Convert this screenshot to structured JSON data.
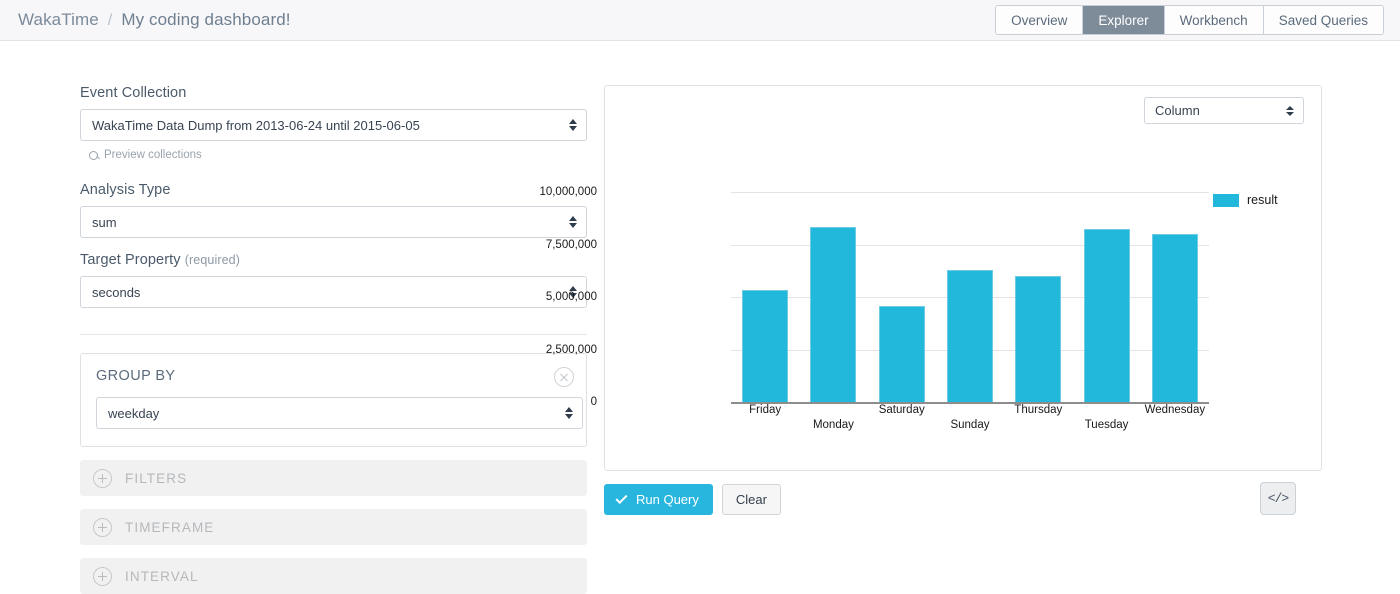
{
  "header": {
    "brand": "WakaTime",
    "separator": "/",
    "page_title": "My coding dashboard!",
    "tabs": [
      {
        "label": "Overview",
        "active": false
      },
      {
        "label": "Explorer",
        "active": true
      },
      {
        "label": "Workbench",
        "active": false
      },
      {
        "label": "Saved Queries",
        "active": false
      }
    ]
  },
  "sidebar": {
    "event_collection": {
      "label": "Event Collection",
      "value": "WakaTime Data Dump from 2013-06-24 until 2015-06-05",
      "preview_link": "Preview collections",
      "preview_icon": "search-icon"
    },
    "analysis_type": {
      "label": "Analysis Type",
      "value": "sum"
    },
    "target_property": {
      "label": "Target Property",
      "required_note": "(required)",
      "value": "seconds"
    },
    "group_by": {
      "title": "GROUP BY",
      "value": "weekday",
      "close_icon": "close-circle-icon"
    },
    "accordions": [
      {
        "label": "FILTERS",
        "icon": "plus-circle-icon"
      },
      {
        "label": "TIMEFRAME",
        "icon": "plus-circle-icon"
      },
      {
        "label": "INTERVAL",
        "icon": "plus-circle-icon"
      }
    ]
  },
  "chart_panel": {
    "viz_type": "Column",
    "run_query_label": "Run Query",
    "run_query_icon": "check-icon",
    "clear_label": "Clear",
    "code_button_label": "</>",
    "code_button_icon": "code-icon"
  },
  "colors": {
    "bar": "#22b8db",
    "bar_border": "#6ecbe4",
    "accent": "#29b6de",
    "tab_active": "#7e8b99"
  },
  "chart_data": {
    "type": "bar",
    "title": "",
    "xlabel": "",
    "ylabel": "",
    "grid": true,
    "legend_position": "right",
    "legend": [
      "result"
    ],
    "ylim": [
      0,
      10000000
    ],
    "yticks": [
      0,
      2500000,
      5000000,
      7500000,
      10000000
    ],
    "ytick_labels": [
      "0",
      "2,500,000",
      "5,000,000",
      "7,500,000",
      "10,000,000"
    ],
    "categories": [
      "Friday",
      "Monday",
      "Saturday",
      "Sunday",
      "Thursday",
      "Tuesday",
      "Wednesday"
    ],
    "series": [
      {
        "name": "result",
        "values": [
          5340000,
          8330000,
          4560000,
          6270000,
          5980000,
          8240000,
          7990000
        ]
      }
    ]
  }
}
